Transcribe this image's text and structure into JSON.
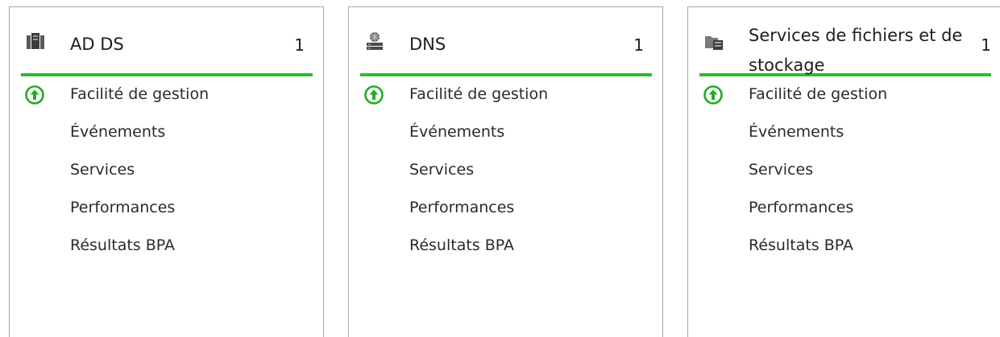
{
  "colors": {
    "accent_green": "#2ebd2b",
    "tile_border": "#a8a8a8",
    "text": "#1e1e1e"
  },
  "tiles": [
    {
      "title": "AD DS",
      "count": "1",
      "icon": "ad-ds-server-icon",
      "items": [
        {
          "label": "Facilité de gestion",
          "status_icon": "green-up-arrow-icon"
        },
        {
          "label": "Événements"
        },
        {
          "label": "Services"
        },
        {
          "label": "Performances"
        },
        {
          "label": "Résultats BPA"
        }
      ]
    },
    {
      "title": "DNS",
      "count": "1",
      "icon": "dns-server-icon",
      "items": [
        {
          "label": "Facilité de gestion",
          "status_icon": "green-up-arrow-icon"
        },
        {
          "label": "Événements"
        },
        {
          "label": "Services"
        },
        {
          "label": "Performances"
        },
        {
          "label": "Résultats BPA"
        }
      ]
    },
    {
      "title": "Services de fichiers et de stockage",
      "count": "1",
      "icon": "file-storage-icon",
      "items": [
        {
          "label": "Facilité de gestion",
          "status_icon": "green-up-arrow-icon"
        },
        {
          "label": "Événements"
        },
        {
          "label": "Services"
        },
        {
          "label": "Performances"
        },
        {
          "label": "Résultats BPA"
        }
      ]
    }
  ]
}
